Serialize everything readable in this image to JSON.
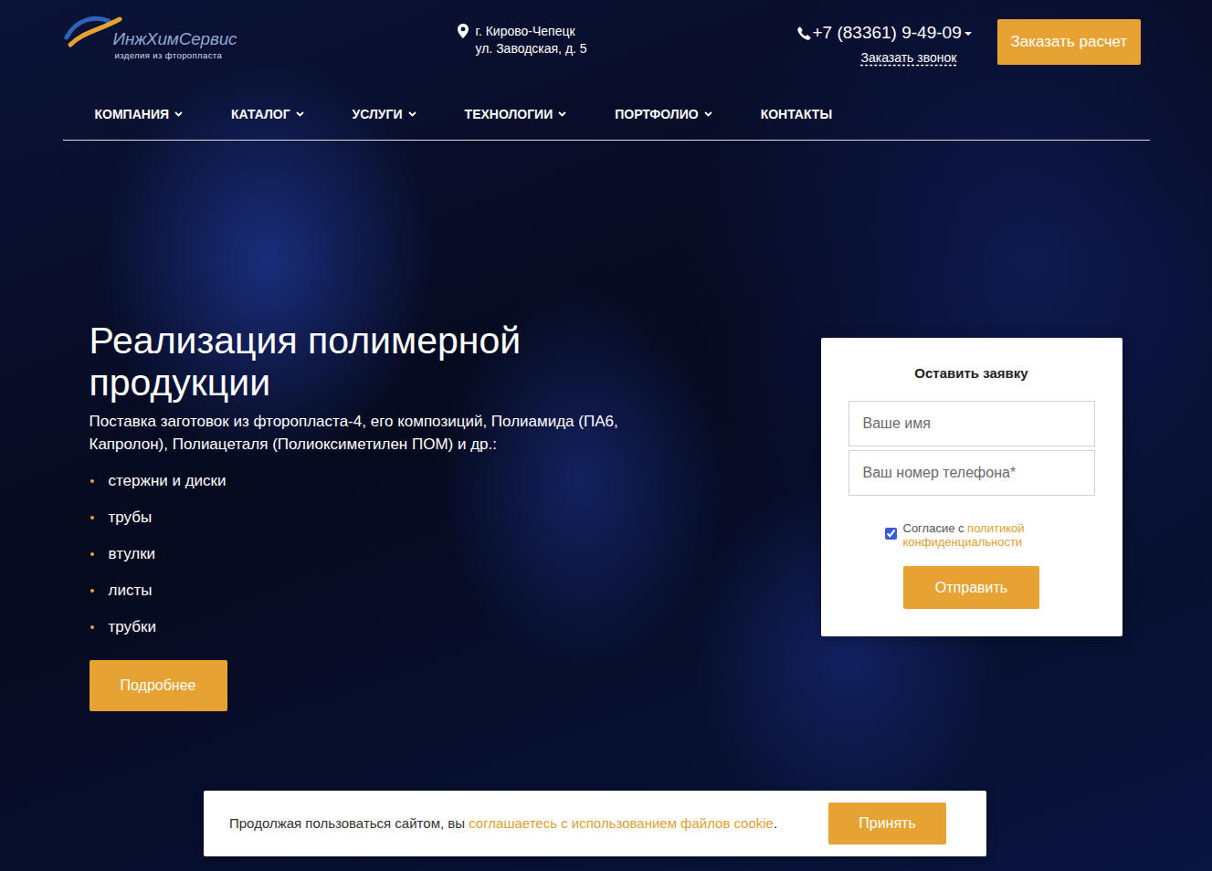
{
  "logo": {
    "name": "ИнжХимСервис",
    "tagline": "изделия из фторопласта"
  },
  "address": {
    "city": "г. Кирово-Чепецк",
    "street": "ул. Заводская, д. 5"
  },
  "phone": {
    "number": "+7 (83361) 9-49-09",
    "has_dropdown": true,
    "callback": "Заказать звонок"
  },
  "header_button": "Заказать расчет",
  "nav": [
    {
      "label": "КОМПАНИЯ",
      "has_dropdown": true
    },
    {
      "label": "КАТАЛОГ",
      "has_dropdown": true
    },
    {
      "label": "УСЛУГИ",
      "has_dropdown": true
    },
    {
      "label": "ТЕХНОЛОГИИ",
      "has_dropdown": true
    },
    {
      "label": "ПОРТФОЛИО",
      "has_dropdown": true
    },
    {
      "label": "КОНТАКТЫ",
      "has_dropdown": false
    }
  ],
  "hero": {
    "title": "Реализация полимерной продукции",
    "subtitle": "Поставка заготовок из фторопласта-4, его композиций, Полиамида (ПА6, Капролон), Полиацеталя (Полиоксиметилен ПОМ) и др.:",
    "items": [
      "стержни и диски",
      "трубы",
      "втулки",
      "листы",
      "трубки"
    ],
    "button": "Подробнее"
  },
  "form": {
    "title": "Оставить заявку",
    "name_placeholder": "Ваше имя",
    "phone_placeholder": "Ваш номер телефона*",
    "consent": {
      "checked": true,
      "text": "Согласие с ",
      "link": "политикой конфиденциальности"
    },
    "submit": "Отправить"
  },
  "cookie": {
    "text": "Продолжая пользоваться сайтом, вы ",
    "link": "соглашаетесь с использованием файлов cookie",
    "end": ".",
    "button": "Принять"
  }
}
